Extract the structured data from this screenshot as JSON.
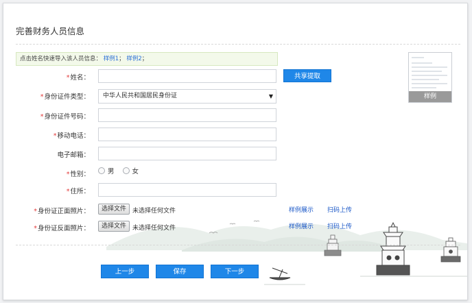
{
  "page": {
    "title": "完善财务人员信息",
    "notice": {
      "text": "点击姓名快速导入该人员信息：",
      "sample1": "样例1",
      "sample2": "样例2",
      "tail": "；"
    }
  },
  "form": {
    "name_label": "姓名：",
    "id_type_label": "身份证件类型：",
    "id_type_value": "中华人民共和国居民身份证",
    "id_number_label": "身份证件号码：",
    "mobile_label": "移动电话：",
    "email_label": "电子邮箱：",
    "gender_label": "性别：",
    "gender_male": "男",
    "gender_female": "女",
    "address_label": "住所：",
    "id_front_label": "身份证正面照片：",
    "id_back_label": "身份证反面照片：",
    "choose_file": "选择文件",
    "no_file": "未选择任何文件",
    "sample_show": "样例展示",
    "scan_upload": "扫码上传",
    "required_mark": "*"
  },
  "buttons": {
    "share": "共享提取",
    "prev": "上一步",
    "save": "保存",
    "next": "下一步"
  },
  "sample_card": {
    "label": "样例"
  },
  "colors": {
    "accent": "#1f87e8",
    "required": "#e23b3b",
    "link": "#1a57c7"
  }
}
